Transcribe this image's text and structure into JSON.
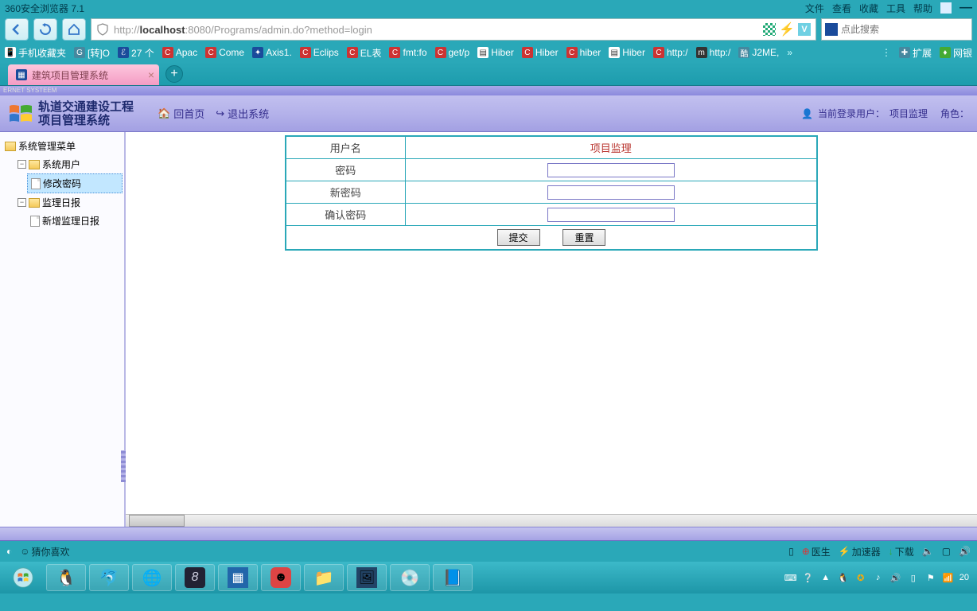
{
  "browser": {
    "title": "360安全浏览器 7.1",
    "menus": [
      "文件",
      "查看",
      "收藏",
      "工具",
      "帮助"
    ],
    "url_pre": "http://",
    "url_host": "localhost",
    "url_rest": ":8080/Programs/admin.do?method=login",
    "search_placeholder": "点此搜索"
  },
  "bookmarks": [
    {
      "label": "手机收藏夹"
    },
    {
      "label": "[转]O"
    },
    {
      "label": "27 个"
    },
    {
      "label": "Apac"
    },
    {
      "label": "Come"
    },
    {
      "label": "Axis1."
    },
    {
      "label": "Eclips"
    },
    {
      "label": "EL表"
    },
    {
      "label": "fmt:fo"
    },
    {
      "label": "get/p"
    },
    {
      "label": "Hiber"
    },
    {
      "label": "Hiber"
    },
    {
      "label": "hiber"
    },
    {
      "label": "Hiber"
    },
    {
      "label": "http:/"
    },
    {
      "label": "http:/"
    },
    {
      "label": "J2ME,"
    }
  ],
  "bm_right": {
    "expand": "扩展",
    "bank": "网银"
  },
  "tab": {
    "title": "建筑项目管理系统"
  },
  "header_strip": "ERNET SYSTEEM",
  "app": {
    "title_line1": "轨道交通建设工程",
    "title_line2": "项目管理系统",
    "home": "回首页",
    "logout": "退出系统",
    "current_user_label": "当前登录用户：",
    "current_user": "项目监理",
    "role_label": "角色："
  },
  "tree": {
    "root": "系统管理菜单",
    "node1": "系统用户",
    "leaf1": "修改密码",
    "node2": "监理日报",
    "leaf2": "新增监理日报"
  },
  "form": {
    "username_label": "用户名",
    "username_value": "项目监理",
    "password_label": "密码",
    "newpwd_label": "新密码",
    "confirm_label": "确认密码",
    "submit": "提交",
    "reset": "重置"
  },
  "status": {
    "guess": "猜你喜欢",
    "doctor": "医生",
    "accel": "加速器",
    "download": "下载"
  },
  "time_corner": "20"
}
